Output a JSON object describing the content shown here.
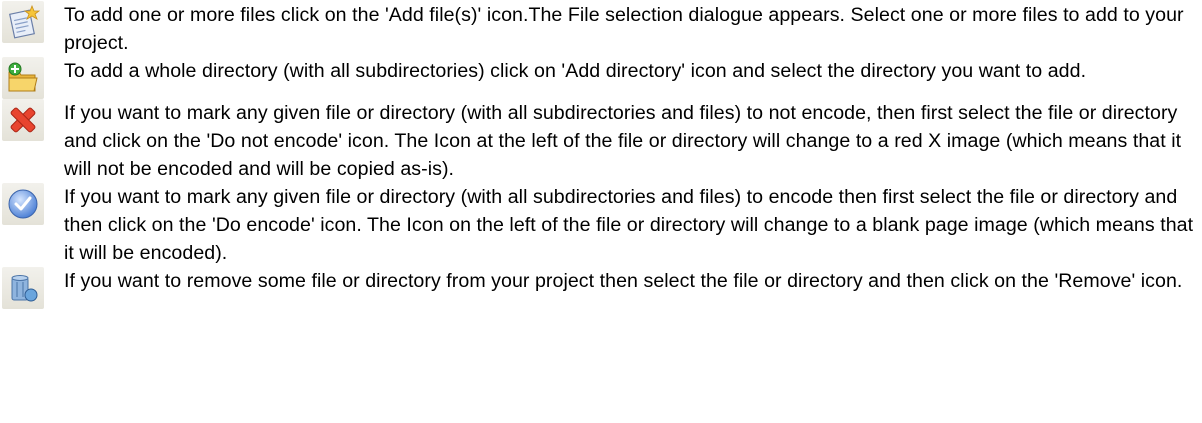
{
  "items": [
    {
      "icon": "add-file-icon",
      "text": "To add one or more files click on the 'Add file(s)' icon.The File selection dialogue appears. Select one or more files to add to your project."
    },
    {
      "icon": "add-directory-icon",
      "text": "To add a whole directory (with all subdirectories) click on 'Add directory' icon and select the directory you want to add."
    },
    {
      "icon": "do-not-encode-icon",
      "text": "If you want to mark any given file or directory (with all subdirectories and files) to not encode, then first select the file or directory and click on the 'Do not encode' icon. The Icon at the left of the file or directory will change to a red X image (which means that it will not be encoded and will be copied as-is)."
    },
    {
      "icon": "do-encode-icon",
      "text": "If you want to mark any given file or directory (with all subdirectories and files) to encode then first select the file or directory and then click on the 'Do encode' icon. The Icon on the left of the file or directory will change to a blank page image (which means that it will be encoded)."
    },
    {
      "icon": "remove-icon",
      "text": "If you want to remove some file or directory from your project then select the file or directory and then click on the 'Remove' icon."
    }
  ]
}
